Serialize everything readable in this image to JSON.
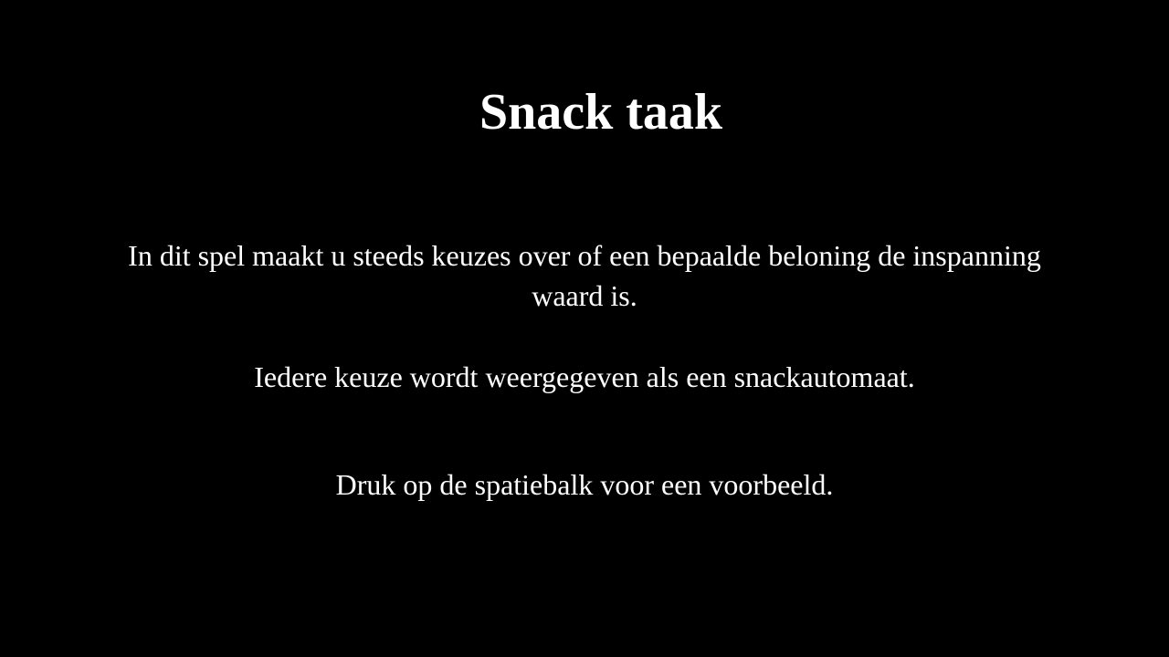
{
  "instructions": {
    "title": "Snack taak",
    "paragraph_1": "In dit spel maakt u steeds keuzes over of een bepaalde beloning de inspanning waard is.",
    "paragraph_2": "Iedere keuze wordt weergegeven als een snackautomaat.",
    "paragraph_3": "Druk op de spatiebalk voor een voorbeeld."
  },
  "colors": {
    "background": "#000000",
    "text": "#ffffff"
  }
}
